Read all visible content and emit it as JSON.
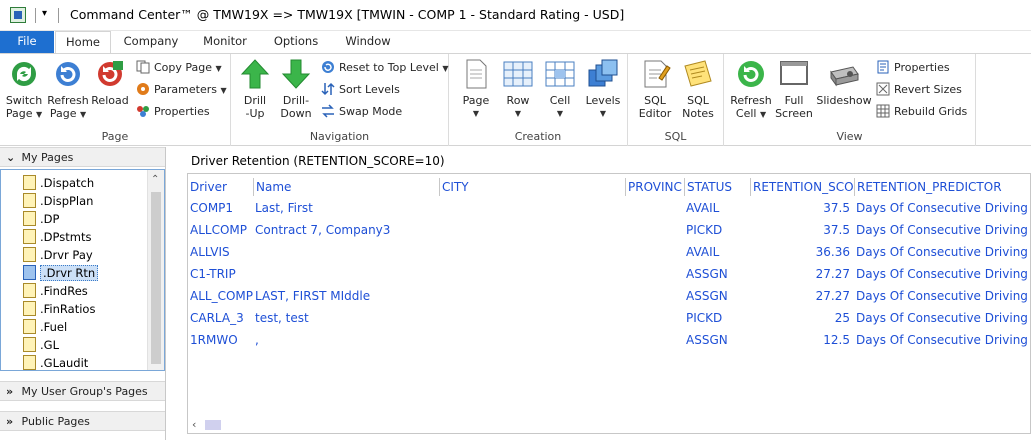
{
  "window": {
    "title": "Command Center™ @ TMW19X => TMW19X [TMWIN - COMP 1 - Standard Rating - USD]"
  },
  "tabs": [
    {
      "label": "File"
    },
    {
      "label": "Home"
    },
    {
      "label": "Company"
    },
    {
      "label": "Monitor"
    },
    {
      "label": "Options"
    },
    {
      "label": "Window"
    }
  ],
  "ribbon": {
    "page_group": {
      "label": "Page",
      "switch_page": [
        "Switch",
        "Page"
      ],
      "refresh_page": [
        "Refresh",
        "Page"
      ],
      "reload": "Reload",
      "copy_page": "Copy Page",
      "parameters": "Parameters",
      "properties": "Properties"
    },
    "navigation_group": {
      "label": "Navigation",
      "drill_up": [
        "Drill",
        "-Up"
      ],
      "drill_down": [
        "Drill-",
        "Down"
      ],
      "reset_top": "Reset to Top Level",
      "sort_levels": "Sort Levels",
      "swap_mode": "Swap Mode"
    },
    "creation_group": {
      "label": "Creation",
      "page": "Page",
      "row": "Row",
      "cell": "Cell",
      "levels": "Levels"
    },
    "sql_group": {
      "label": "SQL",
      "sql_editor": [
        "SQL",
        "Editor"
      ],
      "sql_notes": [
        "SQL",
        "Notes"
      ]
    },
    "view_group": {
      "label": "View",
      "refresh_cell": [
        "Refresh",
        "Cell"
      ],
      "full_screen": [
        "Full",
        "Screen"
      ],
      "slideshow": "Slideshow",
      "properties": "Properties",
      "revert_sizes": "Revert Sizes",
      "rebuild_grids": "Rebuild Grids"
    }
  },
  "nav": {
    "my_pages": "My Pages",
    "pages": [
      ".Dispatch",
      ".DispPlan",
      ".DP",
      ".DPstmts",
      ".Drvr Pay",
      ".Drvr Rtn",
      ".FindRes",
      ".FinRatios",
      ".Fuel",
      ".GL",
      ".GLaudit"
    ],
    "selected_index": 5,
    "user_group_pages": "My User Group's Pages",
    "public_pages": "Public Pages"
  },
  "grid": {
    "title": "Driver Retention (RETENTION_SCORE=10)",
    "columns": [
      "Driver",
      "Name",
      "CITY",
      "PROVINC",
      "STATUS",
      "RETENTION_SCO",
      "RETENTION_PREDICTOR"
    ],
    "rows": [
      [
        "COMP1",
        "Last, First",
        "",
        "",
        "AVAIL",
        "37.5",
        "Days Of Consecutive Driving"
      ],
      [
        "ALLCOMP",
        "Contract 7, Company3",
        "",
        "",
        "PICKD",
        "37.5",
        "Days Of Consecutive Driving"
      ],
      [
        "ALLVIS",
        "",
        "",
        "",
        "AVAIL",
        "36.36",
        "Days Of Consecutive Driving"
      ],
      [
        "C1-TRIP",
        "",
        "",
        "",
        "ASSGN",
        "27.27",
        "Days Of Consecutive Driving"
      ],
      [
        "ALL_COMP",
        "LAST, FIRST MIddle",
        "",
        "",
        "ASSGN",
        "27.27",
        "Days Of Consecutive Driving"
      ],
      [
        "CARLA_3",
        "test, test",
        "",
        "",
        "PICKD",
        "25",
        "Days Of Consecutive Driving"
      ],
      [
        "1RMWO",
        ",",
        "",
        "",
        "ASSGN",
        "12.5",
        "Days Of Consecutive Driving"
      ]
    ]
  },
  "colors": {
    "accent": "#1e6fd0",
    "grid_text": "#1e4fd6"
  }
}
